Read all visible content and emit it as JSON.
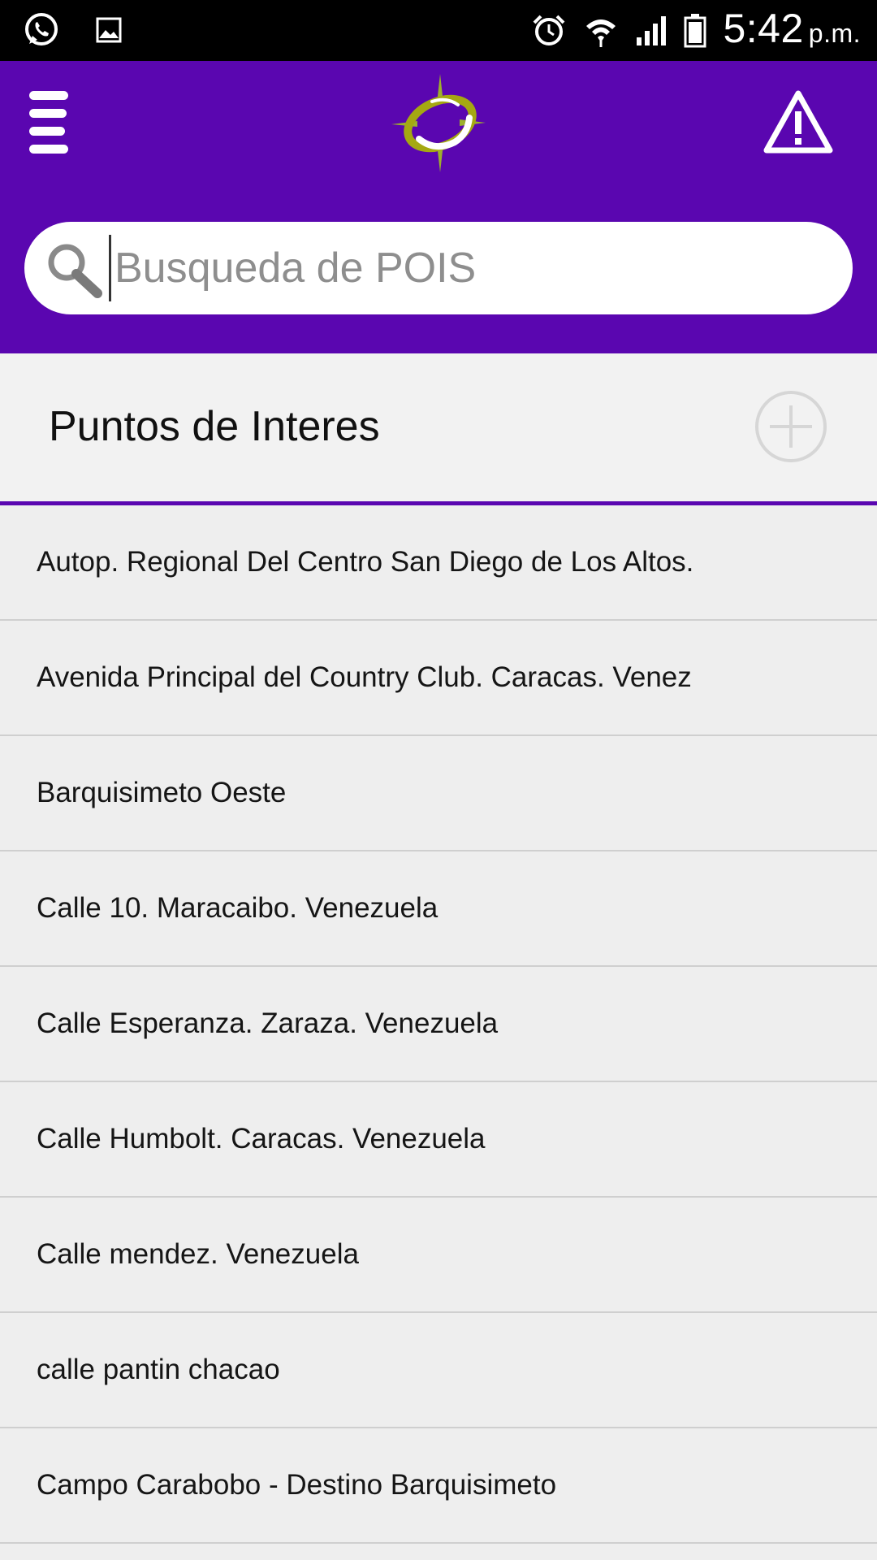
{
  "status_bar": {
    "time": "5:42",
    "ampm": "p.m.",
    "icons": [
      "whatsapp-icon",
      "image-icon",
      "alarm-icon",
      "wifi-icon",
      "signal-icon",
      "battery-icon"
    ]
  },
  "header": {
    "background_color": "#5a06b0",
    "menu_icon": "hamburger-menu-icon",
    "logo": "compass-logo",
    "alert_icon": "warning-triangle-icon"
  },
  "search": {
    "placeholder": "Busqueda de POIS",
    "value": ""
  },
  "section": {
    "title": "Puntos de Interes",
    "add_icon": "add-circle-icon"
  },
  "poi_list": [
    "Autop. Regional Del Centro San Diego de Los Altos.",
    "Avenida Principal del Country Club. Caracas. Venez",
    "Barquisimeto Oeste",
    "Calle 10. Maracaibo. Venezuela",
    "Calle Esperanza. Zaraza. Venezuela",
    "Calle Humbolt. Caracas. Venezuela",
    "Calle mendez. Venezuela",
    "calle pantin chacao",
    "Campo Carabobo - Destino Barquisimeto"
  ]
}
